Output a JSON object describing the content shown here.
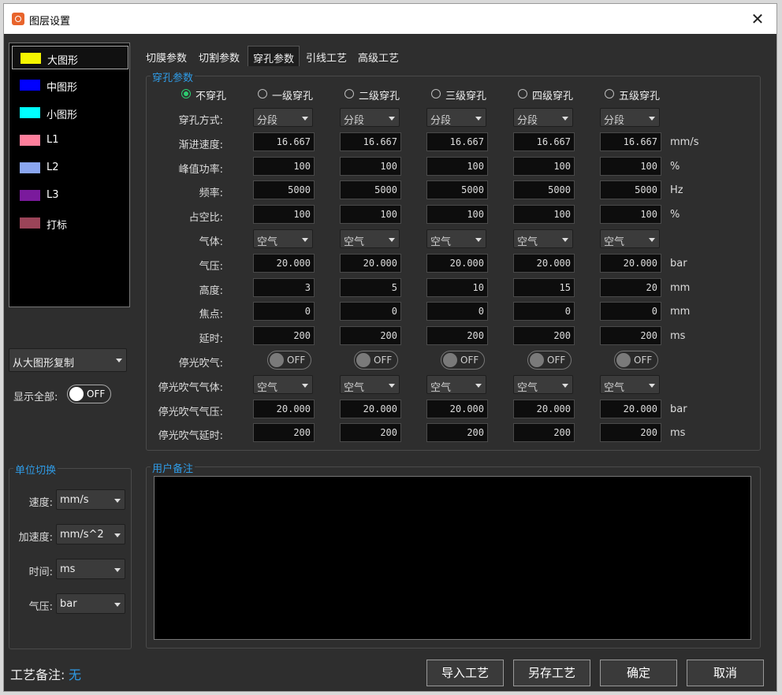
{
  "window": {
    "title": "图层设置"
  },
  "layers": [
    {
      "label": "大图形",
      "color": "#f5f500",
      "selected": true
    },
    {
      "label": "中图形",
      "color": "#0000ff"
    },
    {
      "label": "小图形",
      "color": "#00ffff"
    },
    {
      "label": "L1",
      "color": "#ff7f9c"
    },
    {
      "label": "L2",
      "color": "#8aa6f0"
    },
    {
      "label": "L3",
      "color": "#7a1a9c"
    },
    {
      "label": "打标",
      "color": "#9a4458"
    }
  ],
  "copy_dropdown": "从大图形复制",
  "show_all": {
    "label": "显示全部:",
    "state": "OFF"
  },
  "units": {
    "title": "单位切换",
    "rows": [
      {
        "label": "速度:",
        "value": "mm/s"
      },
      {
        "label": "加速度:",
        "value": "mm/s^2"
      },
      {
        "label": "时间:",
        "value": "ms"
      },
      {
        "label": "气压:",
        "value": "bar"
      }
    ]
  },
  "tabs": [
    {
      "label": "切膜参数"
    },
    {
      "label": "切割参数"
    },
    {
      "label": "穿孔参数",
      "active": true
    },
    {
      "label": "引线工艺"
    },
    {
      "label": "高级工艺"
    }
  ],
  "pierce": {
    "title": "穿孔参数",
    "radios": [
      {
        "label": "不穿孔",
        "checked": true
      },
      {
        "label": "一级穿孔"
      },
      {
        "label": "二级穿孔"
      },
      {
        "label": "三级穿孔"
      },
      {
        "label": "四级穿孔"
      },
      {
        "label": "五级穿孔"
      }
    ],
    "rows": [
      {
        "label": "穿孔方式:",
        "kind": "dropdown",
        "values": [
          "分段",
          "分段",
          "分段",
          "分段",
          "分段"
        ],
        "unit": ""
      },
      {
        "label": "渐进速度:",
        "kind": "number",
        "values": [
          "16.667",
          "16.667",
          "16.667",
          "16.667",
          "16.667"
        ],
        "unit": "mm/s"
      },
      {
        "label": "峰值功率:",
        "kind": "number",
        "values": [
          "100",
          "100",
          "100",
          "100",
          "100"
        ],
        "unit": "%"
      },
      {
        "label": "频率:",
        "kind": "number",
        "values": [
          "5000",
          "5000",
          "5000",
          "5000",
          "5000"
        ],
        "unit": "Hz"
      },
      {
        "label": "占空比:",
        "kind": "number",
        "values": [
          "100",
          "100",
          "100",
          "100",
          "100"
        ],
        "unit": "%"
      },
      {
        "label": "气体:",
        "kind": "dropdown",
        "values": [
          "空气",
          "空气",
          "空气",
          "空气",
          "空气"
        ],
        "unit": ""
      },
      {
        "label": "气压:",
        "kind": "number",
        "values": [
          "20.000",
          "20.000",
          "20.000",
          "20.000",
          "20.000"
        ],
        "unit": "bar"
      },
      {
        "label": "高度:",
        "kind": "number",
        "values": [
          "3",
          "5",
          "10",
          "15",
          "20"
        ],
        "unit": "mm"
      },
      {
        "label": "焦点:",
        "kind": "number",
        "values": [
          "0",
          "0",
          "0",
          "0",
          "0"
        ],
        "unit": "mm"
      },
      {
        "label": "延时:",
        "kind": "number",
        "values": [
          "200",
          "200",
          "200",
          "200",
          "200"
        ],
        "unit": "ms"
      },
      {
        "label": "停光吹气:",
        "kind": "toggle",
        "values": [
          "OFF",
          "OFF",
          "OFF",
          "OFF",
          "OFF"
        ],
        "unit": ""
      },
      {
        "label": "停光吹气气体:",
        "kind": "dropdown",
        "values": [
          "空气",
          "空气",
          "空气",
          "空气",
          "空气"
        ],
        "unit": ""
      },
      {
        "label": "停光吹气气压:",
        "kind": "number",
        "values": [
          "20.000",
          "20.000",
          "20.000",
          "20.000",
          "20.000"
        ],
        "unit": "bar"
      },
      {
        "label": "停光吹气延时:",
        "kind": "number",
        "values": [
          "200",
          "200",
          "200",
          "200",
          "200"
        ],
        "unit": "ms"
      }
    ]
  },
  "notes": {
    "title": "用户备注"
  },
  "footer": {
    "process_note_label": "工艺备注:",
    "process_note_value": "无",
    "buttons": [
      "导入工艺",
      "另存工艺",
      "确定",
      "取消"
    ]
  }
}
